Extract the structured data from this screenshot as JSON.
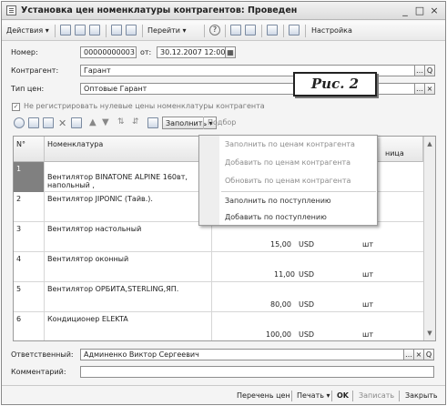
{
  "window": {
    "title": "Установка цен номенклатуры контрагентов: Проведен",
    "controls": {
      "minimize": "_",
      "maximize": "□",
      "close": "×"
    }
  },
  "toolbar": {
    "actions_label": "Действия",
    "goto_label": "Перейти",
    "help_label": "?",
    "settings_label": "Настройка"
  },
  "form": {
    "number_label": "Номер:",
    "number_value": "00000000003",
    "date_label": "от:",
    "date_value": "30.12.2007 12:00:00",
    "contractor_label": "Контрагент:",
    "contractor_value": "Гарант",
    "price_type_label": "Тип цен:",
    "price_type_value": "Оптовые Гарант",
    "checkbox_label": "Не регистрировать нулевые цены номенклатуры контрагента",
    "callout_text": "Рис. 2"
  },
  "table_toolbar": {
    "fill_label": "Заполнить",
    "select_label": "Подбор"
  },
  "table": {
    "headers": {
      "n": "N°",
      "nomenclature": "Номенклатура",
      "unit": "ница"
    },
    "rows": [
      {
        "n": "1",
        "name": "Вентилятор BINATONE ALPINE 160вт, напольный ,",
        "price": "",
        "currency": "",
        "unit": ""
      },
      {
        "n": "2",
        "name": "Вентилятор JIPONIC (Тайв.).",
        "price": "",
        "currency": "",
        "unit": ""
      },
      {
        "n": "3",
        "name": "Вентилятор настольный",
        "price": "15,00",
        "currency": "USD",
        "unit": "шт"
      },
      {
        "n": "4",
        "name": "Вентилятор оконный",
        "price": "11,00",
        "currency": "USD",
        "unit": "шт"
      },
      {
        "n": "5",
        "name": "Вентилятор ОРБИТА,STERLING,ЯП.",
        "price": "80,00",
        "currency": "USD",
        "unit": "шт"
      },
      {
        "n": "6",
        "name": "Кондиционер ELEKTA",
        "price": "100,00",
        "currency": "USD",
        "unit": "шт"
      }
    ]
  },
  "fill_menu": {
    "items": [
      {
        "label": "Заполнить по ценам контрагента",
        "enabled": false
      },
      {
        "label": "Добавить по ценам контрагента",
        "enabled": false
      },
      {
        "label": "Обновить по ценам контрагента",
        "enabled": false
      },
      {
        "label": "Заполнить по поступлению",
        "enabled": true
      },
      {
        "label": "Добавить по поступлению",
        "enabled": true
      }
    ]
  },
  "bottom": {
    "responsible_label": "Ответственный:",
    "responsible_value": "Админенко Виктор Сергеевич",
    "comment_label": "Комментарий:",
    "comment_value": ""
  },
  "footer": {
    "price_list": "Перечень цен",
    "print": "Печать",
    "ok": "OK",
    "save": "Записать",
    "close": "Закрыть"
  }
}
